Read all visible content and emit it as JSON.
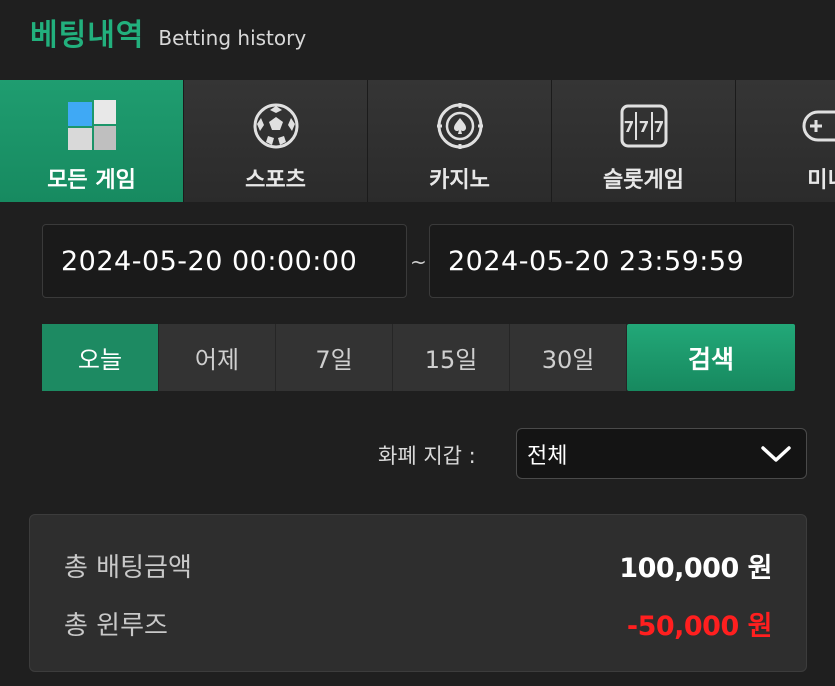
{
  "header": {
    "title": "베팅내역",
    "subtitle": "Betting history"
  },
  "tabs": [
    {
      "label": "모든 게임",
      "icon": "blocks-icon",
      "active": true
    },
    {
      "label": "스포츠",
      "icon": "soccer-ball-icon",
      "active": false
    },
    {
      "label": "카지노",
      "icon": "casino-chip-icon",
      "active": false
    },
    {
      "label": "슬롯게임",
      "icon": "slot-machine-icon",
      "active": false
    },
    {
      "label": "미니",
      "icon": "gamepad-icon",
      "active": false
    }
  ],
  "date_range": {
    "start": "2024-05-20 00:00:00",
    "separator": "~",
    "end": "2024-05-20 23:59:59"
  },
  "period_buttons": [
    {
      "label": "오늘",
      "active": true
    },
    {
      "label": "어제",
      "active": false
    },
    {
      "label": "7일",
      "active": false
    },
    {
      "label": "15일",
      "active": false
    },
    {
      "label": "30일",
      "active": false
    }
  ],
  "search_label": "검색",
  "currency": {
    "label": "화폐 지갑 :",
    "selected": "전체"
  },
  "summary": {
    "total_bet_label": "총 배팅금액",
    "total_bet_value": "100,000 원",
    "total_winloss_label": "총 윈루즈",
    "total_winloss_value": "-50,000 원"
  },
  "colors": {
    "accent": "#1d9a6c",
    "negative": "#ff1f1f",
    "title": "#22b07d"
  }
}
